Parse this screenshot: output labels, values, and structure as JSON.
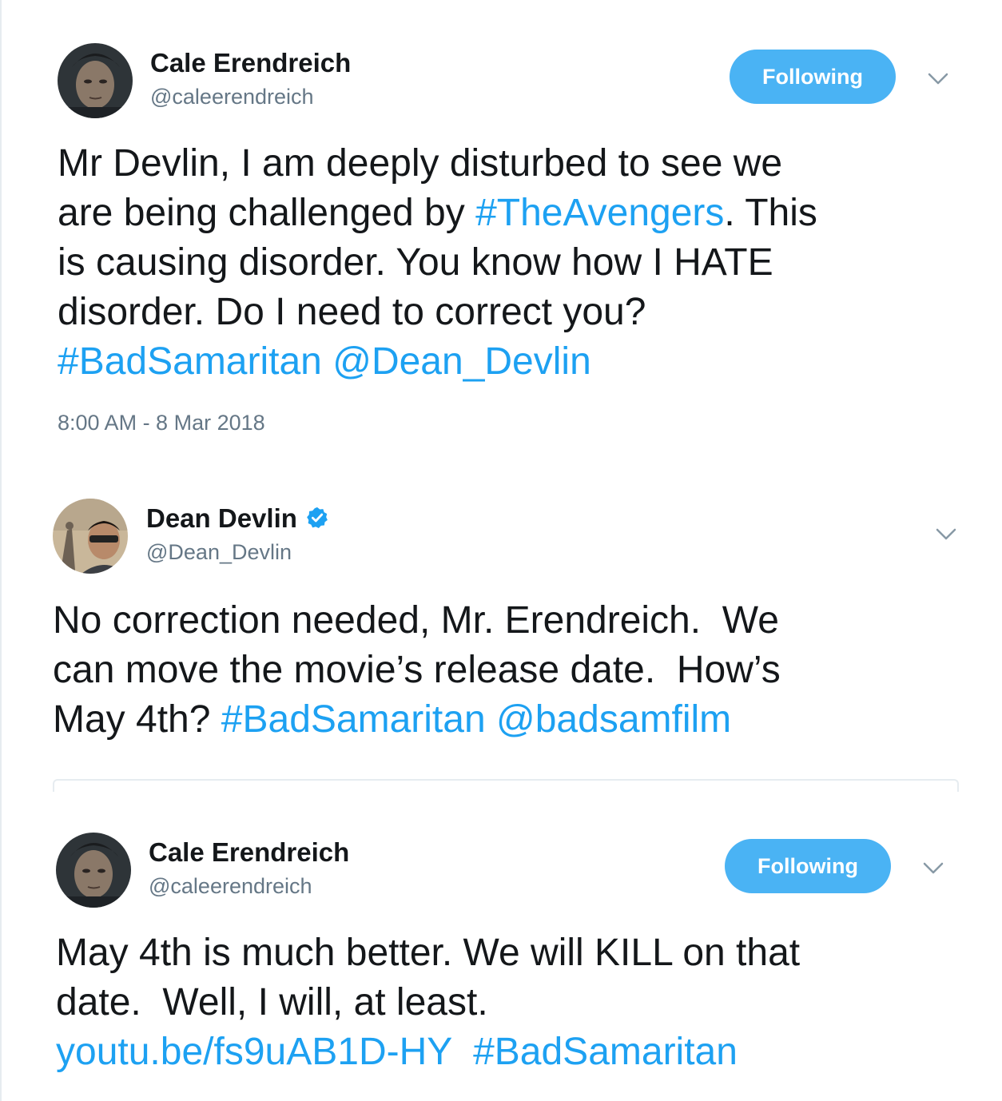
{
  "tweets": [
    {
      "name": "Cale Erendreich",
      "handle": "@caleerendreich",
      "follow_label": "Following",
      "text_lines": [
        [
          {
            "t": "Mr Devlin, I am deeply disturbed to see we"
          }
        ],
        [
          {
            "t": "are being challenged by "
          },
          {
            "t": "#TheAvengers",
            "link": true
          },
          {
            "t": ". This"
          }
        ],
        [
          {
            "t": "is causing disorder. You know how I HATE"
          }
        ],
        [
          {
            "t": "disorder. Do I need to correct you?"
          }
        ],
        [
          {
            "t": "#BadSamaritan",
            "link": true
          },
          {
            "t": " "
          },
          {
            "t": "@Dean_Devlin",
            "link": true
          }
        ]
      ],
      "timestamp": "8:00 AM - 8 Mar 2018"
    },
    {
      "name": "Dean Devlin",
      "handle": "@Dean_Devlin",
      "verified": true,
      "text_lines": [
        [
          {
            "t": "No correction needed, Mr. Erendreich.  We"
          }
        ],
        [
          {
            "t": "can move the movie’s release date.  How’s"
          }
        ],
        [
          {
            "t": "May 4th? "
          },
          {
            "t": "#BadSamaritan",
            "link": true
          },
          {
            "t": " "
          },
          {
            "t": "@badsamfilm",
            "link": true
          }
        ]
      ]
    },
    {
      "name": "Cale Erendreich",
      "handle": "@caleerendreich",
      "follow_label": "Following",
      "text_lines": [
        [
          {
            "t": "May 4th is much better. We will KILL on that"
          }
        ],
        [
          {
            "t": "date.  Well, I will, at least."
          }
        ],
        [
          {
            "t": "youtu.be/fs9uAB1D-HY",
            "link": true
          },
          {
            "t": "  "
          },
          {
            "t": "#BadSamaritan",
            "link": true
          }
        ]
      ]
    }
  ],
  "colors": {
    "link": "#1da1f2",
    "button": "#4ab3f4",
    "secondary_text": "#657786",
    "verified": "#1da1f2"
  },
  "icons": {
    "chevron": "chevron-down-icon",
    "verified": "verified-badge-icon"
  }
}
